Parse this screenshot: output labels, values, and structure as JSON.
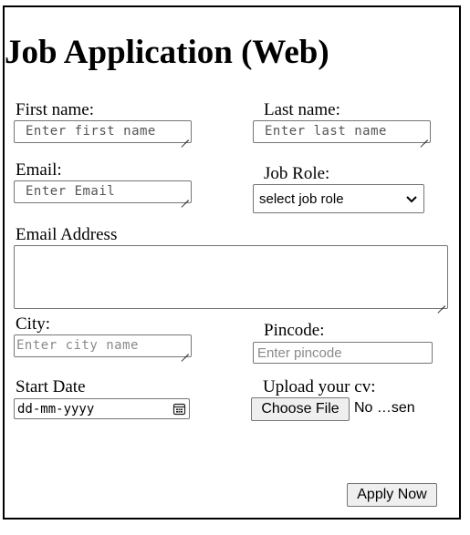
{
  "form": {
    "title": "Job Application (Web)",
    "first_name": {
      "label": "First name:",
      "placeholder": "Enter first name"
    },
    "last_name": {
      "label": "Last name:",
      "placeholder": "Enter last name"
    },
    "email": {
      "label": "Email:",
      "placeholder": "Enter Email"
    },
    "job_role": {
      "label": "Job Role:",
      "selected": "select job role"
    },
    "email_address": {
      "label": "Email Address",
      "value": ""
    },
    "city": {
      "label": "City:",
      "placeholder": "Enter city name"
    },
    "pincode": {
      "label": "Pincode:",
      "placeholder": "Enter pincode"
    },
    "start_date": {
      "label": "Start Date",
      "placeholder": "dd-mm-yyyy"
    },
    "upload_cv": {
      "label": "Upload your cv:",
      "button": "Choose File",
      "status": "No …sen"
    },
    "submit_label": "Apply Now"
  }
}
